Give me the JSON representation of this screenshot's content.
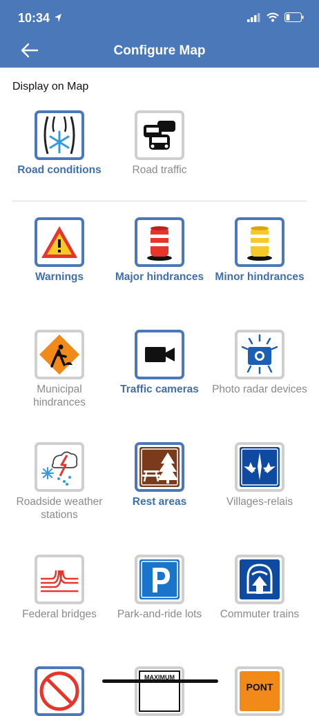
{
  "status_bar": {
    "time": "10:34"
  },
  "header": {
    "title": "Configure Map"
  },
  "section": {
    "label": "Display on Map"
  },
  "layers": [
    {
      "label": "Road conditions",
      "icon": "road-conditions-icon",
      "enabled": true
    },
    {
      "label": "Road traffic",
      "icon": "road-traffic-icon",
      "enabled": false
    },
    {
      "label": "Warnings",
      "icon": "warning-icon",
      "enabled": true
    },
    {
      "label": "Major hindrances",
      "icon": "major-hindrance-icon",
      "enabled": true
    },
    {
      "label": "Minor hindrances",
      "icon": "minor-hindrance-icon",
      "enabled": true
    },
    {
      "label": "Municipal hindrances",
      "icon": "municipal-hindrance-icon",
      "enabled": false
    },
    {
      "label": "Traffic cameras",
      "icon": "camera-icon",
      "enabled": true
    },
    {
      "label": "Photo radar devices",
      "icon": "photo-radar-icon",
      "enabled": false
    },
    {
      "label": "Roadside weather stations",
      "icon": "weather-station-icon",
      "enabled": false
    },
    {
      "label": "Rest areas",
      "icon": "rest-area-icon",
      "enabled": true
    },
    {
      "label": "Villages-relais",
      "icon": "villages-relais-icon",
      "enabled": false
    },
    {
      "label": "Federal bridges",
      "icon": "federal-bridge-icon",
      "enabled": false
    },
    {
      "label": "Park-and-ride lots",
      "icon": "park-and-ride-icon",
      "enabled": false
    },
    {
      "label": "Commuter trains",
      "icon": "commuter-train-icon",
      "enabled": false
    }
  ],
  "partial_icons": {
    "maximum_sign_text": "MAXIMUM",
    "pont_sign_text": "PONT"
  },
  "colors": {
    "accent": "#4a78b8",
    "header_bg": "#4a78b8",
    "inactive_text": "#8a8a8a",
    "active_text": "#3f6fae"
  }
}
